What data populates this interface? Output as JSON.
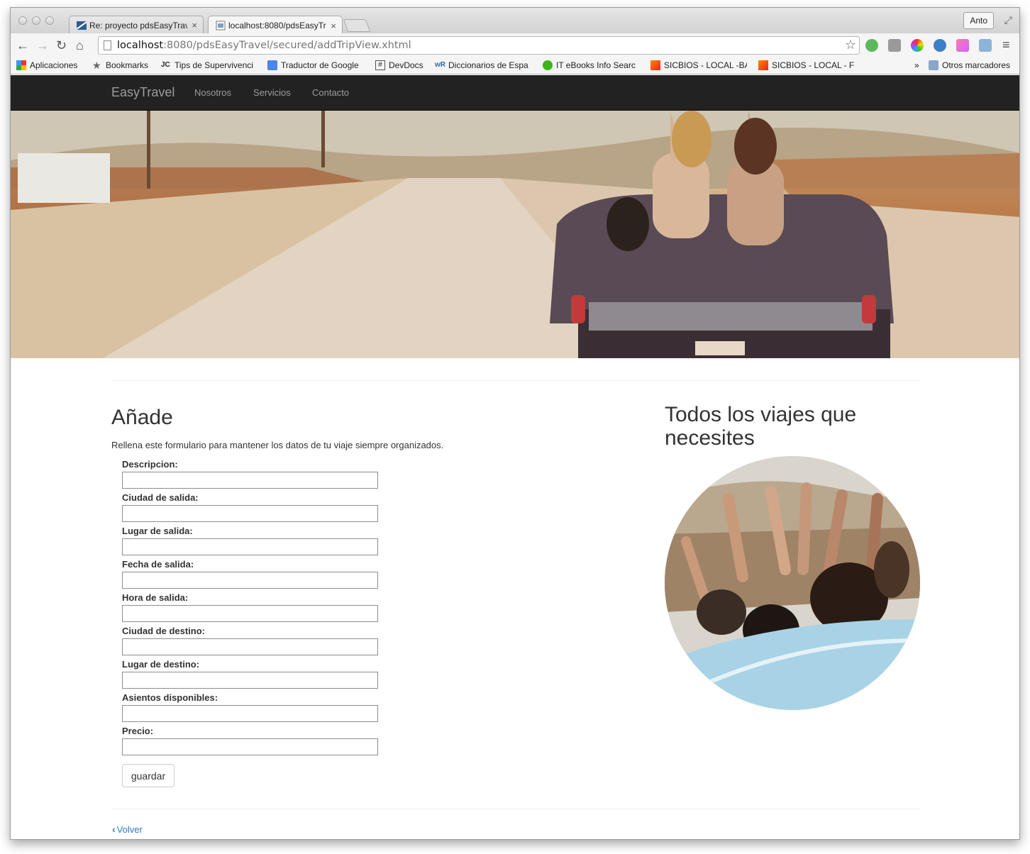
{
  "browser": {
    "tabs": [
      {
        "title": "Re: proyecto pdsEasyTrave",
        "close": "×"
      },
      {
        "title": "localhost:8080/pdsEasyTr",
        "close": "×"
      }
    ],
    "profile": "Anto",
    "url": {
      "host": "localhost",
      "rest": ":8080/pdsEasyTravel/secured/addTripView.xhtml"
    },
    "bookmarks": [
      "Aplicaciones",
      "Bookmarks",
      "Tips de Supervivenci",
      "Traductor de Google",
      "DevDocs",
      "Diccionarios de Espa",
      "IT eBooks Info Searc",
      "SICBIOS - LOCAL -BA",
      "SICBIOS - LOCAL - F",
      "Otros marcadores"
    ],
    "more": "»"
  },
  "site": {
    "brand": "EasyTravel",
    "nav": [
      "Nosotros",
      "Servicios",
      "Contacto"
    ]
  },
  "main": {
    "title": "Añade",
    "lead": "Rellena este formulario para mantener los datos de tu viaje siempre organizados.",
    "fields": [
      {
        "label": "Descripcion:",
        "value": ""
      },
      {
        "label": "Ciudad de salida:",
        "value": ""
      },
      {
        "label": "Lugar de salida:",
        "value": ""
      },
      {
        "label": "Fecha de salida:",
        "value": ""
      },
      {
        "label": "Hora de salida:",
        "value": ""
      },
      {
        "label": "Ciudad de destino:",
        "value": ""
      },
      {
        "label": "Lugar de destino:",
        "value": ""
      },
      {
        "label": "Asientos disponibles:",
        "value": ""
      },
      {
        "label": "Precio:",
        "value": ""
      }
    ],
    "submit": "guardar",
    "back": "Volver"
  },
  "aside": {
    "title": "Todos los viajes que necesites"
  },
  "icons": {
    "back": "chevron-left-icon",
    "star": "bookmark-star-icon",
    "reload": "reload-icon"
  },
  "colors": {
    "navbar": "#222222",
    "link": "#337ab7",
    "navtext": "#9d9d9d"
  }
}
